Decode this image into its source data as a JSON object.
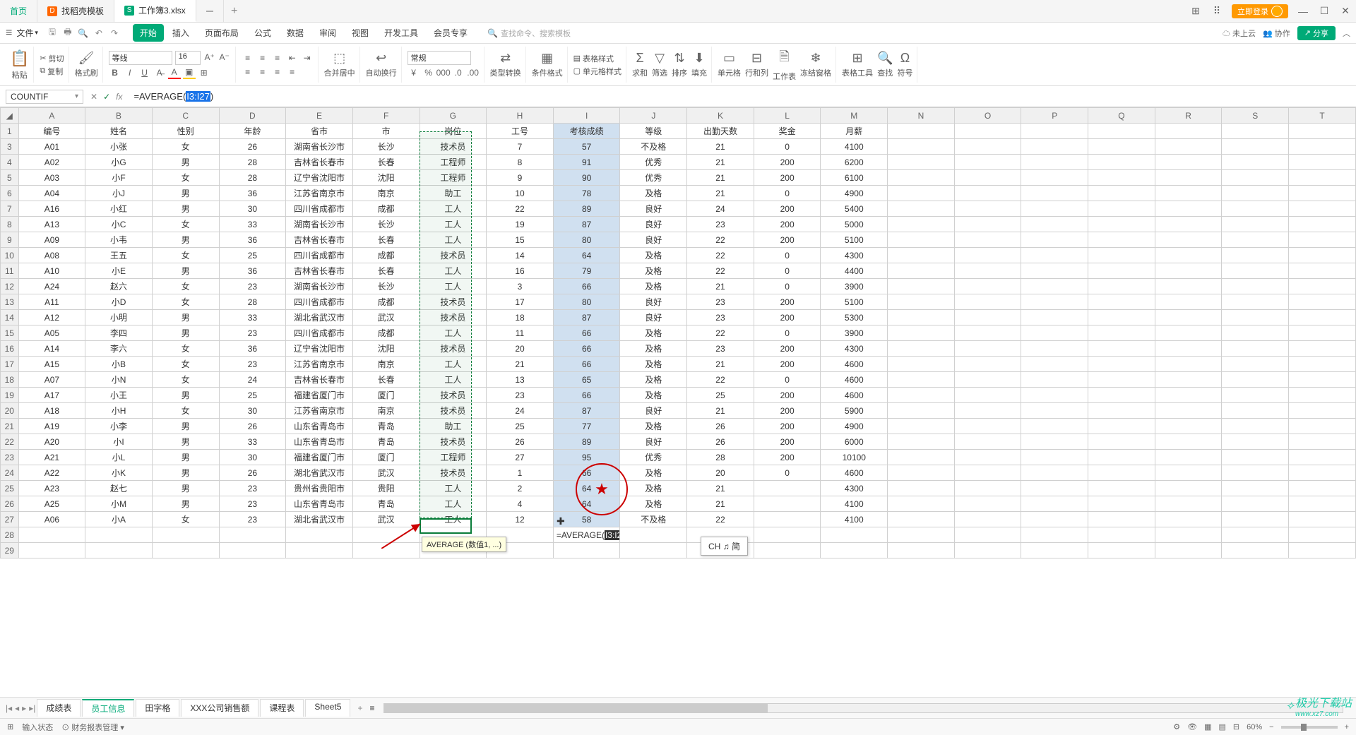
{
  "tabs": {
    "home": "首页",
    "template": "找稻壳模板",
    "active": "工作簿3.xlsx"
  },
  "login": "立即登录",
  "menu": {
    "file": "文件",
    "ribbon": [
      "开始",
      "插入",
      "页面布局",
      "公式",
      "数据",
      "审阅",
      "视图",
      "开发工具",
      "会员专享"
    ],
    "search_placeholder": "查找命令、搜索模板",
    "cloud": "未上云",
    "coop": "协作",
    "share": "分享"
  },
  "ribbon": {
    "paste": "粘贴",
    "cut": "剪切",
    "copy": "复制",
    "fmtpaint": "格式刷",
    "font_name": "等线",
    "font_size": "16",
    "merge": "合并居中",
    "wrap": "自动换行",
    "numfmt": "常规",
    "typeconv": "类型转换",
    "condfmt": "条件格式",
    "tablestyle": "表格样式",
    "cellstyle": "单元格样式",
    "sum": "求和",
    "filter": "筛选",
    "sort": "排序",
    "fill": "填充",
    "cell": "单元格",
    "rowcol": "行和列",
    "sheet": "工作表",
    "freeze": "冻结窗格",
    "tabletool": "表格工具",
    "find": "查找",
    "symbol": "符号"
  },
  "formula_bar": {
    "name": "COUNTIF",
    "prefix": "=AVERAGE(",
    "selected": "I3:I27",
    "suffix": ")"
  },
  "columns": [
    "A",
    "B",
    "C",
    "D",
    "E",
    "F",
    "G",
    "H",
    "I",
    "J",
    "K",
    "L",
    "M",
    "N",
    "O",
    "P",
    "Q",
    "R",
    "S",
    "T"
  ],
  "headers": [
    "编号",
    "姓名",
    "性别",
    "年龄",
    "省市",
    "市",
    "岗位",
    "工号",
    "考核成绩",
    "等级",
    "出勤天数",
    "奖金",
    "月薪"
  ],
  "rows": [
    [
      "A01",
      "小张",
      "女",
      "26",
      "湖南省长沙市",
      "长沙",
      "技术员",
      "7",
      "57",
      "不及格",
      "21",
      "0",
      "4100"
    ],
    [
      "A02",
      "小G",
      "男",
      "28",
      "吉林省长春市",
      "长春",
      "工程师",
      "8",
      "91",
      "优秀",
      "21",
      "200",
      "6200"
    ],
    [
      "A03",
      "小F",
      "女",
      "28",
      "辽宁省沈阳市",
      "沈阳",
      "工程师",
      "9",
      "90",
      "优秀",
      "21",
      "200",
      "6100"
    ],
    [
      "A04",
      "小J",
      "男",
      "36",
      "江苏省南京市",
      "南京",
      "助工",
      "10",
      "78",
      "及格",
      "21",
      "0",
      "4900"
    ],
    [
      "A16",
      "小红",
      "男",
      "30",
      "四川省成都市",
      "成都",
      "工人",
      "22",
      "89",
      "良好",
      "24",
      "200",
      "5400"
    ],
    [
      "A13",
      "小C",
      "女",
      "33",
      "湖南省长沙市",
      "长沙",
      "工人",
      "19",
      "87",
      "良好",
      "23",
      "200",
      "5000"
    ],
    [
      "A09",
      "小韦",
      "男",
      "36",
      "吉林省长春市",
      "长春",
      "工人",
      "15",
      "80",
      "良好",
      "22",
      "200",
      "5100"
    ],
    [
      "A08",
      "王五",
      "女",
      "25",
      "四川省成都市",
      "成都",
      "技术员",
      "14",
      "64",
      "及格",
      "22",
      "0",
      "4300"
    ],
    [
      "A10",
      "小E",
      "男",
      "36",
      "吉林省长春市",
      "长春",
      "工人",
      "16",
      "79",
      "及格",
      "22",
      "0",
      "4400"
    ],
    [
      "A24",
      "赵六",
      "女",
      "23",
      "湖南省长沙市",
      "长沙",
      "工人",
      "3",
      "66",
      "及格",
      "21",
      "0",
      "3900"
    ],
    [
      "A11",
      "小D",
      "女",
      "28",
      "四川省成都市",
      "成都",
      "技术员",
      "17",
      "80",
      "良好",
      "23",
      "200",
      "5100"
    ],
    [
      "A12",
      "小明",
      "男",
      "33",
      "湖北省武汉市",
      "武汉",
      "技术员",
      "18",
      "87",
      "良好",
      "23",
      "200",
      "5300"
    ],
    [
      "A05",
      "李四",
      "男",
      "23",
      "四川省成都市",
      "成都",
      "工人",
      "11",
      "66",
      "及格",
      "22",
      "0",
      "3900"
    ],
    [
      "A14",
      "李六",
      "女",
      "36",
      "辽宁省沈阳市",
      "沈阳",
      "技术员",
      "20",
      "66",
      "及格",
      "23",
      "200",
      "4300"
    ],
    [
      "A15",
      "小B",
      "女",
      "23",
      "江苏省南京市",
      "南京",
      "工人",
      "21",
      "66",
      "及格",
      "21",
      "200",
      "4600"
    ],
    [
      "A07",
      "小N",
      "女",
      "24",
      "吉林省长春市",
      "长春",
      "工人",
      "13",
      "65",
      "及格",
      "22",
      "0",
      "4600"
    ],
    [
      "A17",
      "小王",
      "男",
      "25",
      "福建省厦门市",
      "厦门",
      "技术员",
      "23",
      "66",
      "及格",
      "25",
      "200",
      "4600"
    ],
    [
      "A18",
      "小H",
      "女",
      "30",
      "江苏省南京市",
      "南京",
      "技术员",
      "24",
      "87",
      "良好",
      "21",
      "200",
      "5900"
    ],
    [
      "A19",
      "小李",
      "男",
      "26",
      "山东省青岛市",
      "青岛",
      "助工",
      "25",
      "77",
      "及格",
      "26",
      "200",
      "4900"
    ],
    [
      "A20",
      "小I",
      "男",
      "33",
      "山东省青岛市",
      "青岛",
      "技术员",
      "26",
      "89",
      "良好",
      "26",
      "200",
      "6000"
    ],
    [
      "A21",
      "小L",
      "男",
      "30",
      "福建省厦门市",
      "厦门",
      "工程师",
      "27",
      "95",
      "优秀",
      "28",
      "200",
      "10100"
    ],
    [
      "A22",
      "小K",
      "男",
      "26",
      "湖北省武汉市",
      "武汉",
      "技术员",
      "1",
      "66",
      "及格",
      "20",
      "0",
      "4600"
    ],
    [
      "A23",
      "赵七",
      "男",
      "23",
      "贵州省贵阳市",
      "贵阳",
      "工人",
      "2",
      "64",
      "及格",
      "21",
      "",
      "4300"
    ],
    [
      "A25",
      "小M",
      "男",
      "23",
      "山东省青岛市",
      "青岛",
      "工人",
      "4",
      "64",
      "及格",
      "21",
      "",
      "4100"
    ],
    [
      "A06",
      "小A",
      "女",
      "23",
      "湖北省武汉市",
      "武汉",
      "工人",
      "12",
      "58",
      "不及格",
      "22",
      "",
      "4100"
    ]
  ],
  "cell_formula": {
    "prefix": "=AVERAGE(",
    "sel": "I3:I27",
    "suffix": ")"
  },
  "hint": "AVERAGE (数值1, ...)",
  "ime": "CH ♫ 简",
  "sheet_tabs": [
    "成绩表",
    "员工信息",
    "田字格",
    "XXX公司销售额",
    "课程表",
    "Sheet5"
  ],
  "active_sheet": 1,
  "status": {
    "mode": "输入状态",
    "biz": "财务报表管理",
    "zoom": "60%"
  },
  "watermark": {
    "big": "极光下载站",
    "small": "www.xz7.com"
  }
}
